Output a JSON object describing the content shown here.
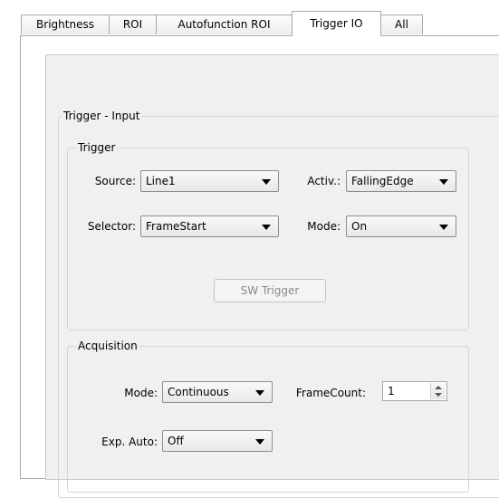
{
  "tabs": [
    {
      "label": "Brightness",
      "active": false
    },
    {
      "label": "ROI",
      "active": false
    },
    {
      "label": "Autofunction ROI",
      "active": false
    },
    {
      "label": "Trigger IO",
      "active": true
    },
    {
      "label": "All",
      "active": false
    }
  ],
  "trigger_input": {
    "title": "Trigger - Input",
    "trigger": {
      "title": "Trigger",
      "source_label": "Source:",
      "source_value": "Line1",
      "activation_label": "Activ.:",
      "activation_value": "FallingEdge",
      "selector_label": "Selector:",
      "selector_value": "FrameStart",
      "mode_label": "Mode:",
      "mode_value": "On",
      "sw_trigger_label": "SW Trigger"
    },
    "acquisition": {
      "title": "Acquisition",
      "mode_label": "Mode:",
      "mode_value": "Continuous",
      "framecount_label": "FrameCount:",
      "framecount_value": "1",
      "exp_auto_label": "Exp. Auto:",
      "exp_auto_value": "Off"
    }
  },
  "colors": {
    "panel_background": "#f0f0f0",
    "border": "#a9a9a9",
    "disabled_text": "#8a8a8a"
  }
}
